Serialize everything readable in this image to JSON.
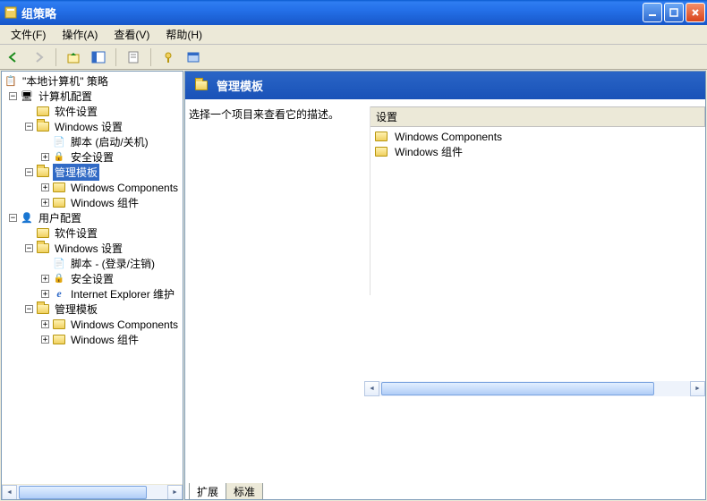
{
  "window": {
    "title": "组策略"
  },
  "menu": {
    "file": "文件(F)",
    "action": "操作(A)",
    "view": "查看(V)",
    "help": "帮助(H)"
  },
  "tree": {
    "root": "\"本地计算机\" 策略",
    "computer_config": "计算机配置",
    "cc_software": "软件设置",
    "cc_windows": "Windows 设置",
    "cc_scripts": "脚本 (启动/关机)",
    "cc_security": "安全设置",
    "cc_admin": "管理模板",
    "cc_admin_wc": "Windows Components",
    "cc_admin_wcc": "Windows 组件",
    "user_config": "用户配置",
    "uc_software": "软件设置",
    "uc_windows": "Windows 设置",
    "uc_scripts": "脚本 - (登录/注销)",
    "uc_security": "安全设置",
    "uc_ie": "Internet Explorer 维护",
    "uc_admin": "管理模板",
    "uc_admin_wc": "Windows Components",
    "uc_admin_wcc": "Windows 组件"
  },
  "content": {
    "header": "管理模板",
    "desc": "选择一个项目来查看它的描述。",
    "col_setting": "设置",
    "items": {
      "wc": "Windows Components",
      "wcc": "Windows 组件"
    }
  },
  "tabs": {
    "extended": "扩展",
    "standard": "标准"
  }
}
